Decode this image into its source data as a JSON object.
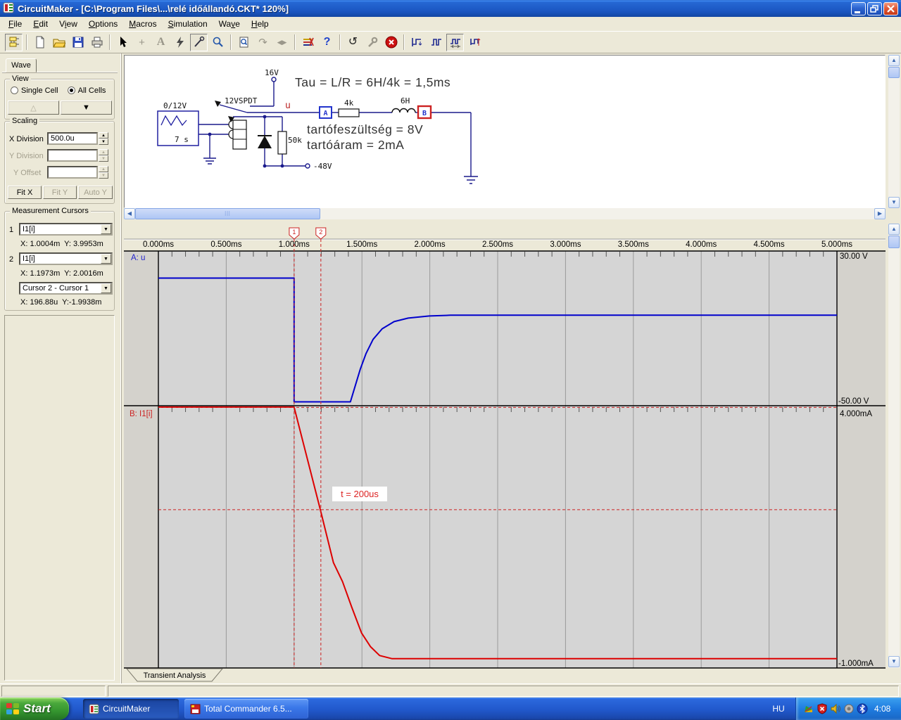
{
  "titlebar": {
    "title": "CircuitMaker - [C:\\Program Files\\...\\relé időállandó.CKT* 120%]"
  },
  "menu": {
    "items": [
      {
        "label": "File",
        "u": 0
      },
      {
        "label": "Edit",
        "u": 0
      },
      {
        "label": "View",
        "u": 1
      },
      {
        "label": "Options",
        "u": 0
      },
      {
        "label": "Macros",
        "u": 0
      },
      {
        "label": "Simulation",
        "u": 0
      },
      {
        "label": "Wave",
        "u": 2
      },
      {
        "label": "Help",
        "u": 0
      }
    ]
  },
  "toolbar": {
    "plus_glyph": "+",
    "text_glyph": "A",
    "rotate_glyph": "↷",
    "split_glyph": "◀▶",
    "help_glyph": "?",
    "undo_glyph": "↺"
  },
  "panel": {
    "tab": "Wave",
    "view": {
      "title": "View",
      "single": "Single Cell",
      "all": "All Cells",
      "up_glyph": "△",
      "down_glyph": "▼"
    },
    "scaling": {
      "title": "Scaling",
      "x_label": "X Division",
      "x_value": "500.0u",
      "y_label": "Y Division",
      "y_value": "",
      "offset_label": "Y Offset",
      "offset_value": "",
      "fit_x": "Fit X",
      "fit_y": "Fit Y",
      "auto_y": "Auto Y"
    },
    "cursors": {
      "title": "Measurement Cursors",
      "c1_index": "1",
      "c1_signal": "I1[i]",
      "c1_readout": "X: 1.0004m  Y: 3.9953m",
      "c2_index": "2",
      "c2_signal": "I1[i]",
      "c2_readout": "X: 1.1973m  Y: 2.0016m",
      "diff_signal": "Cursor 2 - Cursor 1",
      "diff_readout": "X: 196.88u  Y:-1.9938m"
    }
  },
  "circuit": {
    "supply": "16V",
    "relay": "12VSPDT",
    "source": "0/12V",
    "source_sub": "7 s",
    "node_u": "u",
    "probe_a": "A",
    "probe_b": "B",
    "r1": "4k",
    "l1": "6H",
    "r2": "50k",
    "vneg": "-48V",
    "note_tau": "Tau = L/R = 6H/4k = 1,5ms",
    "note_hold_v": "tartófeszültség = 8V",
    "note_hold_i": "tartóáram = 2mA"
  },
  "wave": {
    "cell_a_label": "A: u",
    "cell_a_top": "30.00 V",
    "cell_a_bottom": "-50.00 V",
    "cell_b_label": "B: I1[i]",
    "cell_b_top": "4.000mA",
    "cell_b_bottom": "-1.000mA",
    "cursor1": "1",
    "cursor2": "2",
    "annotation": "t = 200us",
    "bottom_tab": "Transient Analysis"
  },
  "chart_data": {
    "type": "line",
    "title": "Transient Analysis",
    "x_axis": {
      "unit": "ms",
      "t_start": 0,
      "t_end": 5,
      "tick_step": 0.5,
      "ticks": [
        "0.000ms",
        "0.500ms",
        "1.000ms",
        "1.500ms",
        "2.000ms",
        "2.500ms",
        "3.000ms",
        "3.500ms",
        "4.000ms",
        "4.500ms",
        "5.000ms"
      ]
    },
    "cells": [
      {
        "name": "A: u",
        "signal": "u",
        "color": "#0000cc",
        "unit": "V",
        "y_max": 30,
        "y_min": -50,
        "y_max_label": "30.00 V",
        "y_min_label": "-50.00 V",
        "points": [
          [
            0,
            16
          ],
          [
            1.0,
            16
          ],
          [
            1.0,
            -48
          ],
          [
            1.415,
            -48
          ],
          [
            1.452,
            -39.4
          ],
          [
            1.488,
            -31.0
          ],
          [
            1.53,
            -23.0
          ],
          [
            1.582,
            -15.7
          ],
          [
            1.649,
            -10.2
          ],
          [
            1.737,
            -6.5
          ],
          [
            1.841,
            -4.7
          ],
          [
            1.996,
            -3.6
          ],
          [
            2.152,
            -3.2
          ],
          [
            5.0,
            -3.2
          ]
        ]
      },
      {
        "name": "B: I1[i]",
        "signal": "I1[i]",
        "color": "#dd0000",
        "unit": "mA",
        "y_max": 4,
        "y_min": -1,
        "y_max_label": "4.000mA",
        "y_min_label": "-1.000mA",
        "points": [
          [
            0,
            4
          ],
          [
            1.0,
            4
          ],
          [
            1.1934,
            2.0
          ],
          [
            1.29,
            0.97
          ],
          [
            1.357,
            0.6
          ],
          [
            1.424,
            0.11
          ],
          [
            1.497,
            -0.4
          ],
          [
            1.564,
            -0.67
          ],
          [
            1.63,
            -0.84
          ],
          [
            1.72,
            -0.9
          ],
          [
            5.0,
            -0.9
          ]
        ]
      }
    ],
    "cursors": [
      {
        "id": "1",
        "t": 1.0004,
        "value": 3.9953,
        "cell": 1
      },
      {
        "id": "2",
        "t": 1.1973,
        "value": 2.0016,
        "cell": 1
      }
    ],
    "delta": {
      "x": "196.88u",
      "y": "-1.9938m"
    },
    "annotation": {
      "text": "t = 200us",
      "near_t": 1.55,
      "cell": 1
    },
    "grid": "vertical gridlines every 0.5ms, minor ticks every 0.1ms",
    "legend_position": "left-of-plot"
  },
  "taskbar": {
    "start": "Start",
    "tasks": [
      {
        "label": "CircuitMaker"
      },
      {
        "label": "Total Commander 6.5..."
      }
    ],
    "lang": "HU",
    "clock": "4:08",
    "tray_icons": [
      "app",
      "security-alert",
      "volume",
      "device",
      "bluetooth"
    ]
  }
}
